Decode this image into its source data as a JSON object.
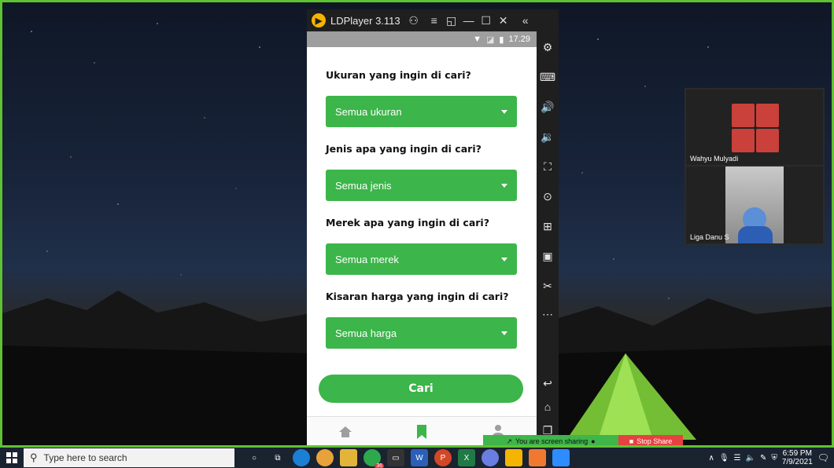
{
  "emulator": {
    "title": "LDPlayer 3.113",
    "status_time": "17.29"
  },
  "app": {
    "questions": [
      {
        "label": "Ukuran yang ingin di cari?",
        "value": "Semua ukuran"
      },
      {
        "label": "Jenis apa yang ingin di cari?",
        "value": "Semua jenis"
      },
      {
        "label": "Merek apa yang ingin di cari?",
        "value": "Semua merek"
      },
      {
        "label": "Kisaran harga yang ingin di cari?",
        "value": "Semua harga"
      }
    ],
    "search_button": "Cari",
    "nav_icons": [
      "home-icon",
      "bookmark-icon",
      "profile-icon"
    ],
    "accent_color": "#3cb54a"
  },
  "meeting": {
    "participants": [
      {
        "name": "Wahyu Mulyadi"
      },
      {
        "name": "Liga Danu S"
      }
    ]
  },
  "share_bar": {
    "message": "You are screen sharing",
    "stop_label": "Stop Share"
  },
  "taskbar": {
    "search_placeholder": "Type here to search",
    "time": "6:59 PM",
    "date": "7/9/2021",
    "badge_count": "36"
  }
}
